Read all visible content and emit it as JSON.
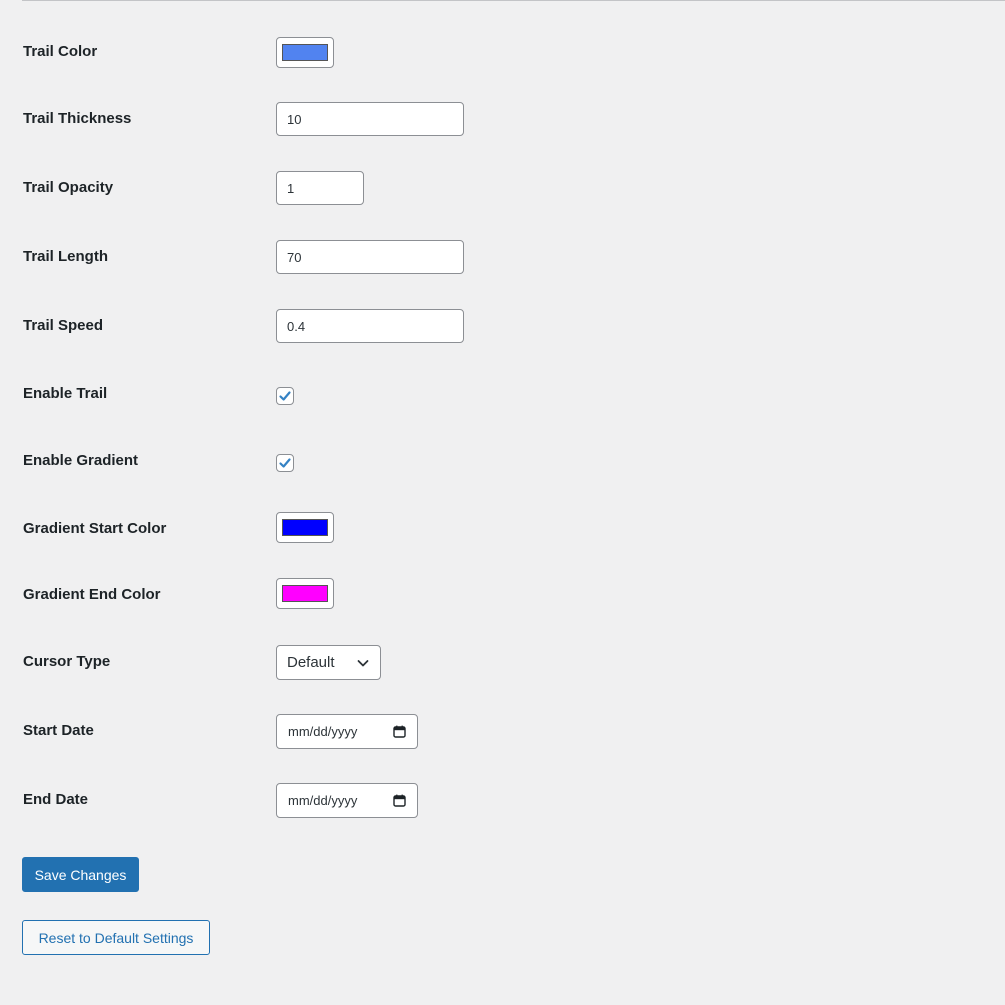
{
  "fields": {
    "trail_color": {
      "label": "Trail Color",
      "value": "#5183f0"
    },
    "trail_thickness": {
      "label": "Trail Thickness",
      "value": "10"
    },
    "trail_opacity": {
      "label": "Trail Opacity",
      "value": "1"
    },
    "trail_length": {
      "label": "Trail Length",
      "value": "70"
    },
    "trail_speed": {
      "label": "Trail Speed",
      "value": "0.4"
    },
    "enable_trail": {
      "label": "Enable Trail",
      "checked": true
    },
    "enable_gradient": {
      "label": "Enable Gradient",
      "checked": true
    },
    "gradient_start_color": {
      "label": "Gradient Start Color",
      "value": "#0000ff"
    },
    "gradient_end_color": {
      "label": "Gradient End Color",
      "value": "#ff00ff"
    },
    "cursor_type": {
      "label": "Cursor Type",
      "selected": "Default"
    },
    "start_date": {
      "label": "Start Date",
      "placeholder": "mm/dd/yyyy"
    },
    "end_date": {
      "label": "End Date",
      "placeholder": "mm/dd/yyyy"
    }
  },
  "buttons": {
    "save_label": "Save Changes",
    "reset_label": "Reset to Default Settings"
  },
  "colors": {
    "primary": "#2271b1",
    "checkmark": "#3582c4"
  },
  "icons": {
    "checkbox": "checkmark-icon",
    "select": "chevron-down-icon",
    "date": "calendar-icon"
  }
}
